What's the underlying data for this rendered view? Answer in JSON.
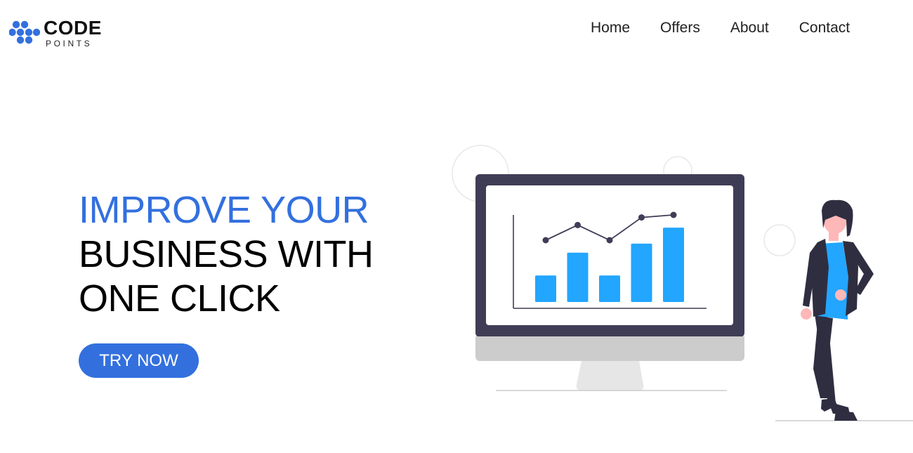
{
  "brand": {
    "name": "CODE",
    "tagline": "POINTS",
    "color": "#3370de"
  },
  "nav": {
    "items": [
      {
        "label": "Home"
      },
      {
        "label": "Offers"
      },
      {
        "label": "About"
      },
      {
        "label": "Contact"
      }
    ]
  },
  "hero": {
    "title_accent": "IMPROVE YOUR",
    "title_line2": "BUSINESS WITH",
    "title_line3": "ONE CLICK",
    "cta_label": "TRY NOW",
    "accent_color": "#3370de"
  },
  "illustration": {
    "icon": "business-analytics-illustration",
    "monitor_frame_color": "#3f3d56",
    "bar_color": "#22a6ff",
    "bars": [
      0.35,
      0.65,
      0.35,
      0.77,
      0.98
    ],
    "line_points": [
      0.5,
      0.8,
      0.5,
      0.95,
      1.0
    ]
  }
}
